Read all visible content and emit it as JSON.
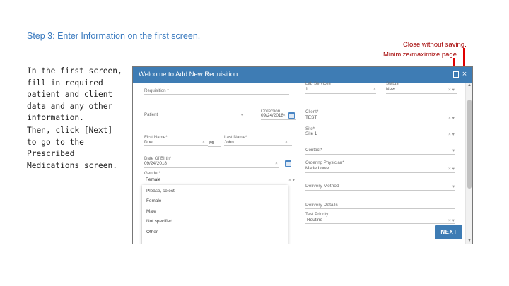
{
  "slide": {
    "title": "Step 3: Enter Information on the first screen.",
    "instruction_1": "In the first screen, fill in required patient and client data and any other information.",
    "instruction_2": "Then, click [Next] to go to the Prescribed Medications screen."
  },
  "annotations": {
    "close_note": "Close without saving.",
    "minmax_note": "Minimize/maximize page."
  },
  "modal": {
    "title": "Welcome to Add New Requisition",
    "close_icon": "×",
    "fields": {
      "requisition_label": "Requisition *",
      "lab_services_label": "Lab Services",
      "lab_services_value": "1",
      "status_label": "Status",
      "status_value": "New",
      "patient_label": "Patient",
      "collection_label": "Collection",
      "collection_value": "09/24/2018",
      "client_label": "Client*",
      "client_value": "TEST",
      "site_label": "Site*",
      "site_value": "Site 1",
      "first_name_label": "First Name*",
      "first_name_value": "Doe",
      "mi_label": "MI",
      "last_name_label": "Last Name*",
      "last_name_value": "John",
      "contact_label": "Contact*",
      "dob_label": "Date Of Birth*",
      "dob_value": "09/24/2018",
      "ordering_physician_label": "Ordering Physician*",
      "ordering_physician_value": "Marie Lowe",
      "gender_label": "Gender*",
      "gender_value": "Female",
      "delivery_method_label": "Delivery Method",
      "delivery_details_label": "Delivery Details",
      "test_priority_label": "Test Priority",
      "test_priority_value": "Routine"
    },
    "gender_options": [
      "Please, select",
      "Female",
      "Male",
      "Not specified",
      "Other"
    ],
    "next_label": "NEXT"
  },
  "colors": {
    "accent": "#3e7cb4",
    "title_text": "#3a7abf",
    "annotation": "#a30000",
    "marker": "#e00000"
  }
}
